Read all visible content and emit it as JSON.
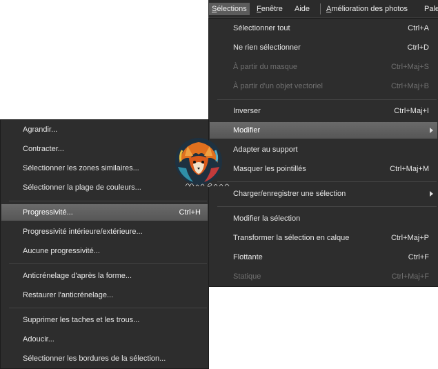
{
  "menubar": {
    "items": [
      {
        "label": "Sélections",
        "hotkey_first": "S",
        "rest": "élections",
        "active": true
      },
      {
        "label": "Fenêtre",
        "hotkey_first": "F",
        "rest": "enêtre"
      },
      {
        "label": "Aide"
      },
      {
        "label": "Amélioration des photos",
        "hotkey_first": "A",
        "rest": "mélioration des photos"
      },
      {
        "label": "Pale"
      }
    ]
  },
  "main_menu": {
    "items": [
      {
        "label": "Sélectionner tout",
        "shortcut": "Ctrl+A"
      },
      {
        "label": "Ne rien sélectionner",
        "shortcut": "Ctrl+D"
      },
      {
        "label": "À partir du masque",
        "shortcut": "Ctrl+Maj+S"
      },
      {
        "label": "À partir d'un objet vectoriel",
        "shortcut": "Ctrl+Maj+B"
      },
      {
        "label": "Inverser",
        "shortcut": "Ctrl+Maj+I"
      },
      {
        "label": "Modifier",
        "shortcut": ""
      },
      {
        "label": "Adapter au support",
        "shortcut": ""
      },
      {
        "label": "Masquer les pointillés",
        "shortcut": "Ctrl+Maj+M"
      },
      {
        "label": "Charger/enregistrer une sélection",
        "shortcut": ""
      },
      {
        "label": "Modifier la sélection",
        "shortcut": ""
      },
      {
        "label": "Transformer la sélection en calque",
        "shortcut": "Ctrl+Maj+P"
      },
      {
        "label": "Flottante",
        "shortcut": "Ctrl+F"
      },
      {
        "label": "Statique",
        "shortcut": "Ctrl+Maj+F"
      }
    ]
  },
  "sub_menu": {
    "items": [
      {
        "label": "Agrandir...",
        "shortcut": ""
      },
      {
        "label": "Contracter...",
        "shortcut": ""
      },
      {
        "label": "Sélectionner les zones similaires...",
        "shortcut": ""
      },
      {
        "label": "Sélectionner la plage de couleurs...",
        "shortcut": ""
      },
      {
        "label": "Progressivité...",
        "shortcut": "Ctrl+H"
      },
      {
        "label": "Progressivité intérieure/extérieure...",
        "shortcut": ""
      },
      {
        "label": "Aucune progressivité...",
        "shortcut": ""
      },
      {
        "label": "Anticrénelage d'après la forme...",
        "shortcut": ""
      },
      {
        "label": "Restaurer l'anticrénelage...",
        "shortcut": ""
      },
      {
        "label": "Supprimer les taches et les trous...",
        "shortcut": ""
      },
      {
        "label": "Adoucir...",
        "shortcut": ""
      },
      {
        "label": "Sélectionner les bordures de la sélection...",
        "shortcut": ""
      }
    ]
  },
  "watermark": {
    "text": "Michelle Graph",
    "icon": "fox-logo-icon"
  },
  "colors": {
    "menu_bg": "#2d2d2d",
    "highlight": "#606060",
    "disabled": "#707070",
    "text": "#e6e6e6"
  }
}
